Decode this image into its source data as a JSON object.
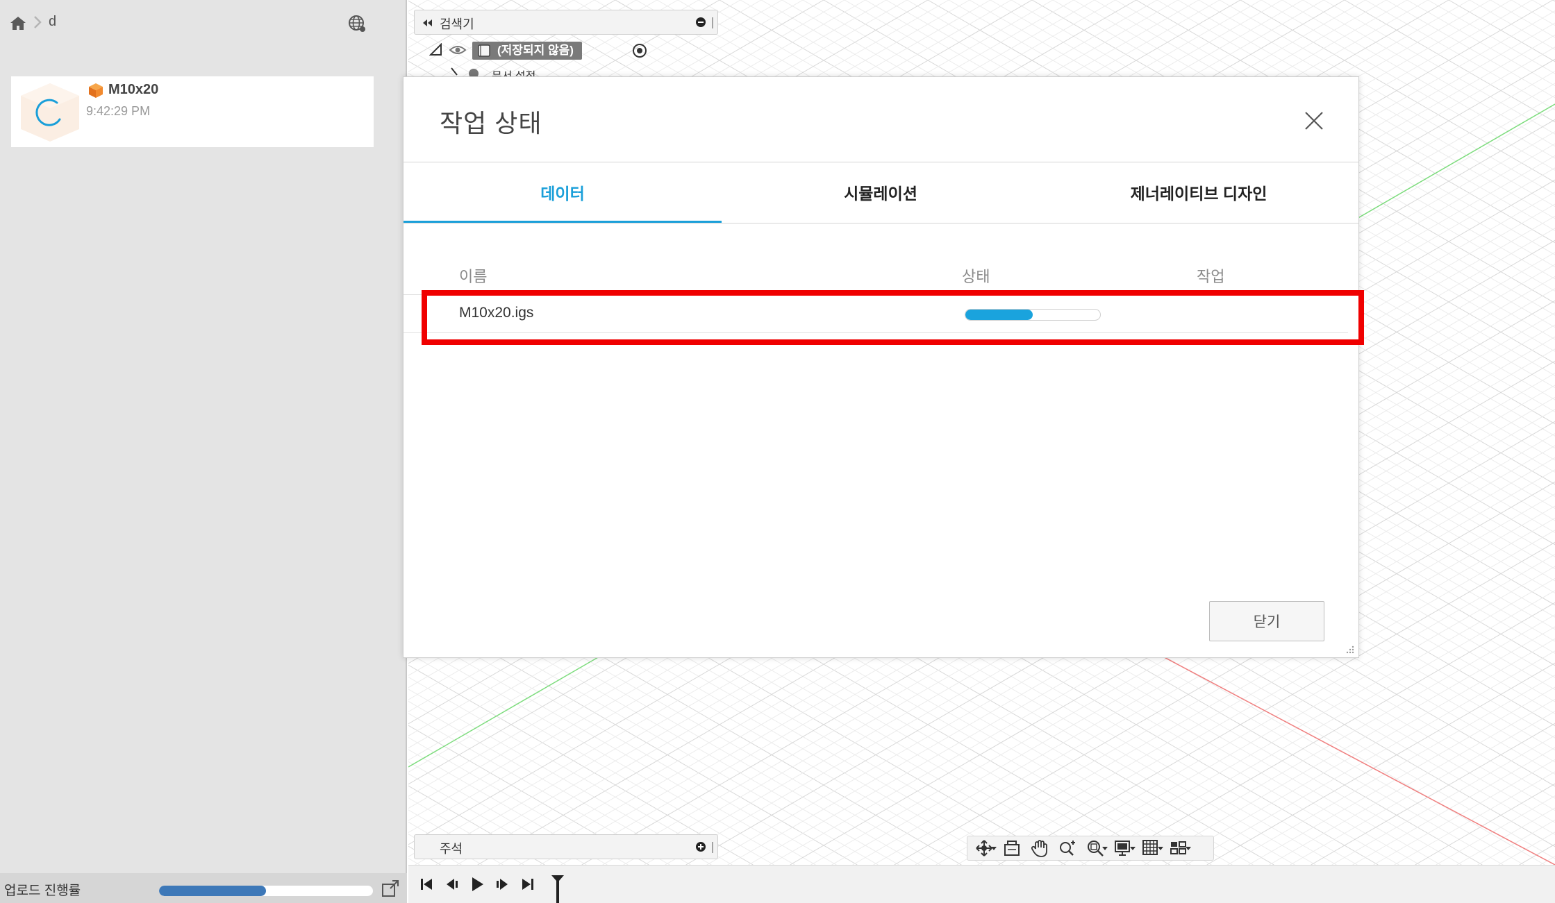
{
  "left_panel": {
    "breadcrumb": {
      "current_folder": "d"
    },
    "file": {
      "name": "M10x20",
      "time": "9:42:29 PM"
    },
    "upload": {
      "label": "업로드 진행률",
      "progress_fraction": 0.5
    }
  },
  "canvas": {
    "browser": {
      "title": "검색기",
      "document_label": "(저장되지 않음)",
      "sub_item_label": "문서 설정"
    },
    "comments": {
      "title": "주석"
    }
  },
  "dialog": {
    "title": "작업 상태",
    "tabs": [
      {
        "label": "데이터",
        "active": true
      },
      {
        "label": "시뮬레이션",
        "active": false
      },
      {
        "label": "제너레이티브 디자인",
        "active": false
      }
    ],
    "table": {
      "headers": {
        "name": "이름",
        "status": "상태",
        "action": "작업"
      },
      "rows": [
        {
          "name": "M10x20.igs",
          "progress_fraction": 0.5,
          "action": ""
        }
      ]
    },
    "close_button_label": "닫기"
  },
  "colors": {
    "accent": "#1a9fd9",
    "highlight": "#f00000",
    "upload_fill": "#3d78b8",
    "progress_fill": "#1aa3dd",
    "axis_green": "#7ddc7d",
    "axis_red": "#f08080"
  },
  "icons": {
    "breadcrumb": [
      "home-icon",
      "chevron-right-icon"
    ],
    "panel": [
      "globe-icon",
      "cube-icon",
      "loading-spinner-icon",
      "popout-icon"
    ],
    "toolbar": [
      "orbit-icon",
      "look-at-icon",
      "pan-icon",
      "zoom-icon",
      "fit-icon",
      "display-settings-icon",
      "grid-icon",
      "viewports-icon"
    ],
    "timeline": [
      "skip-start-icon",
      "step-back-icon",
      "play-icon",
      "step-forward-icon",
      "skip-end-icon",
      "timeline-marker-icon"
    ]
  }
}
